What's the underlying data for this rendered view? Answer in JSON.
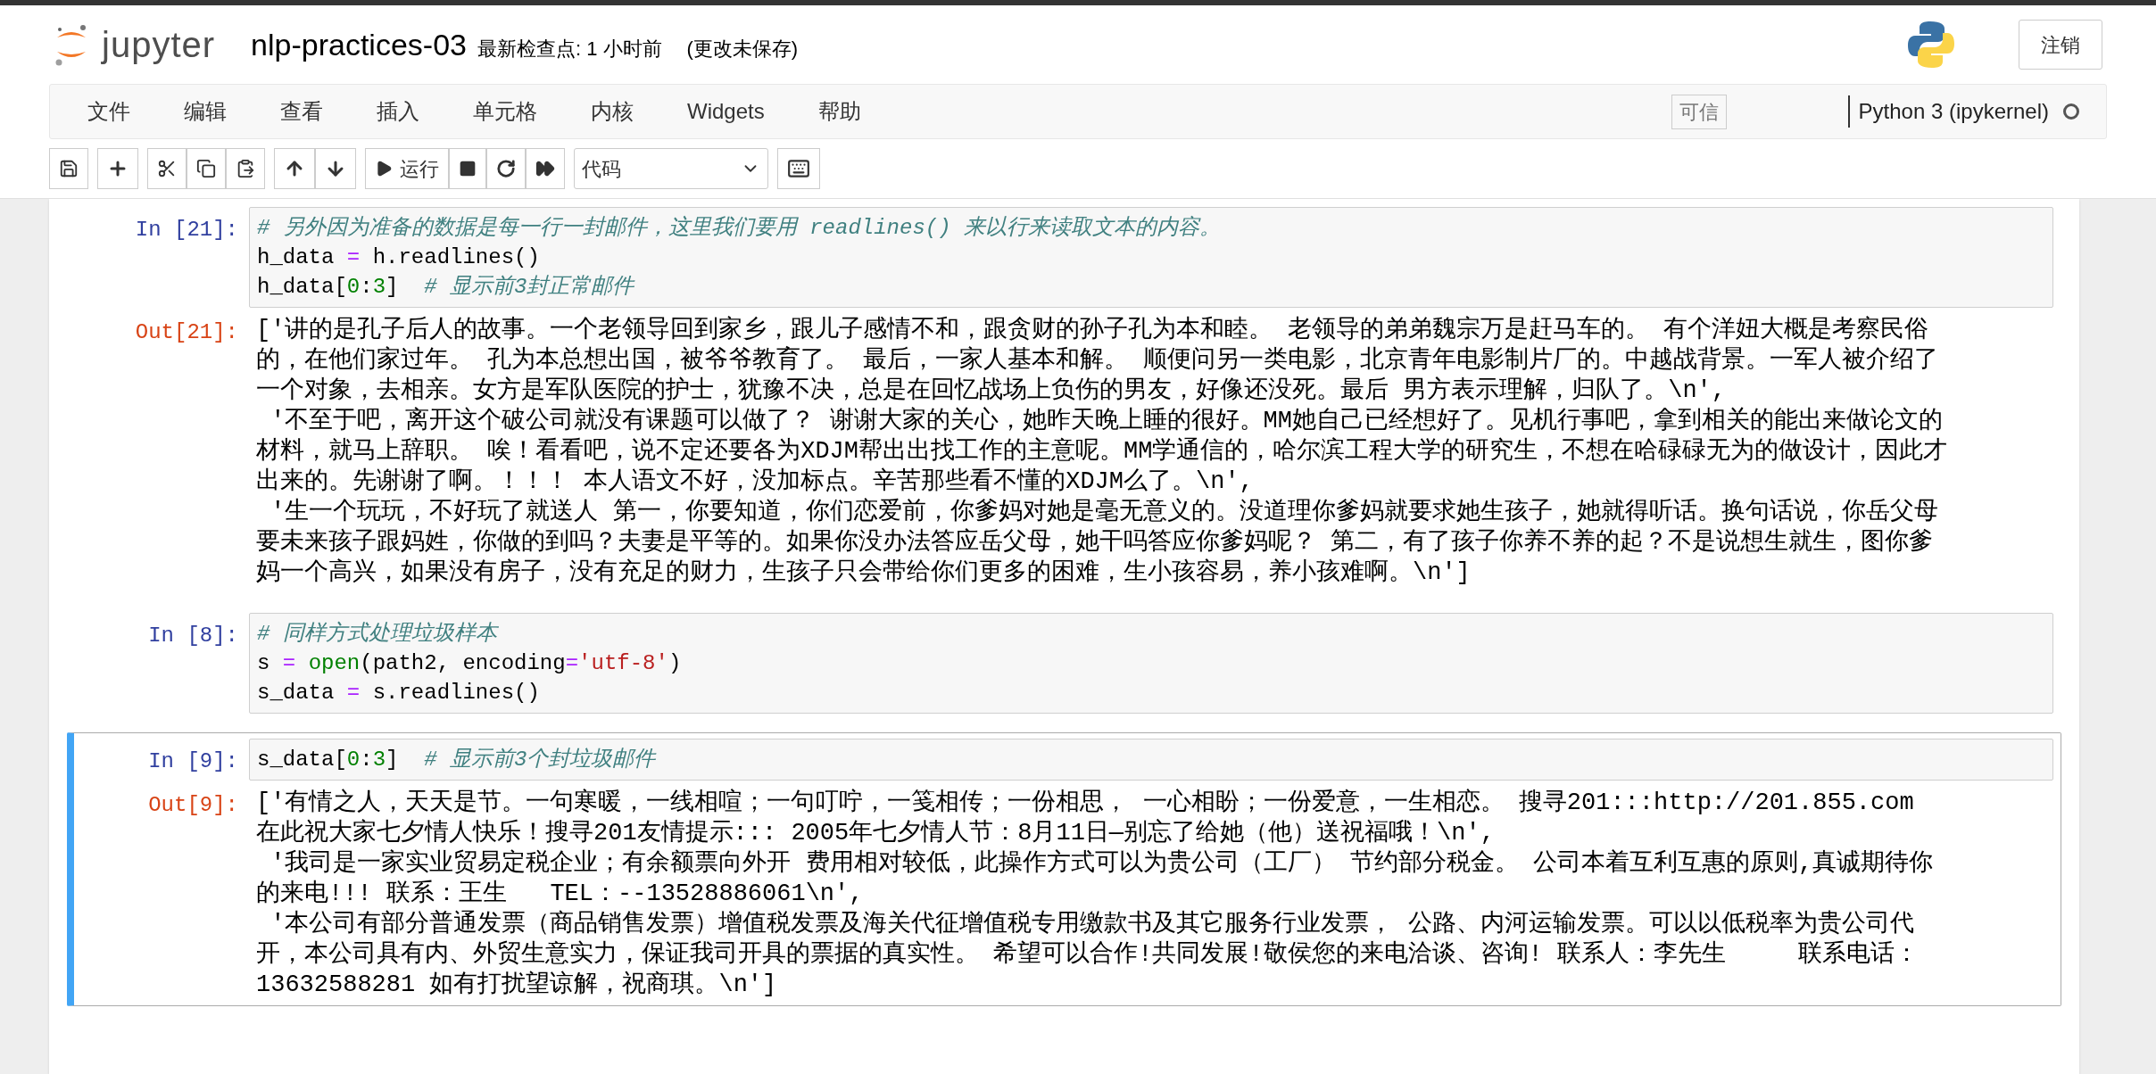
{
  "header": {
    "logo_text": "jupyter",
    "notebook_name": "nlp-practices-03",
    "checkpoint": "最新检查点: 1 小时前",
    "unsaved": "(更改未保存)",
    "logout": "注销"
  },
  "menu": [
    "文件",
    "编辑",
    "查看",
    "插入",
    "单元格",
    "内核",
    "Widgets",
    "帮助"
  ],
  "trusted": "可信",
  "kernel": {
    "name": "Python 3 (ipykernel)",
    "busy": false
  },
  "toolbar": {
    "run_label": "运行",
    "cell_type": "代码"
  },
  "cells": [
    {
      "prompt": "In [21]:",
      "selected": false,
      "code": [
        [
          {
            "kind": "comment",
            "text": "# 另外因为准备的数据是每一行一封邮件，这里我们要用 readlines() 来以行来读取文本的内容。"
          }
        ],
        [
          {
            "kind": "plain",
            "text": "h_data "
          },
          {
            "kind": "operator",
            "text": "="
          },
          {
            "kind": "plain",
            "text": " h.readlines()"
          }
        ],
        [
          {
            "kind": "plain",
            "text": "h_data["
          },
          {
            "kind": "number",
            "text": "0"
          },
          {
            "kind": "plain",
            "text": ":"
          },
          {
            "kind": "number",
            "text": "3"
          },
          {
            "kind": "plain",
            "text": "]  "
          },
          {
            "kind": "comment",
            "text": "# 显示前3封正常邮件"
          }
        ]
      ],
      "output": {
        "prompt": "Out[21]:",
        "lines": [
          "['讲的是孔子后人的故事。一个老领导回到家乡，跟儿子感情不和，跟贪财的孙子孔为本和睦。 老领导的弟弟魏宗万是赶马车的。 有个洋妞大概是考察民俗",
          "的，在他们家过年。 孔为本总想出国，被爷爷教育了。 最后，一家人基本和解。 顺便问另一类电影，北京青年电影制片厂的。中越战背景。一军人被介绍了",
          "一个对象，去相亲。女方是军队医院的护士，犹豫不决，总是在回忆战场上负伤的男友，好像还没死。最后 男方表示理解，归队了。\\n',",
          " '不至于吧，离开这个破公司就没有课题可以做了？ 谢谢大家的关心，她昨天晚上睡的很好。MM她自己已经想好了。见机行事吧，拿到相关的能出来做论文的",
          "材料，就马上辞职。 唉！看看吧，说不定还要各为XDJM帮出出找工作的主意呢。MM学通信的，哈尔滨工程大学的研究生，不想在哈碌碌无为的做设计，因此才",
          "出来的。先谢谢了啊。！！！ 本人语文不好，没加标点。辛苦那些看不懂的XDJM么了。\\n',",
          " '生一个玩玩，不好玩了就送人 第一，你要知道，你们恋爱前，你爹妈对她是毫无意义的。没道理你爹妈就要求她生孩子，她就得听话。换句话说，你岳父母",
          "要未来孩子跟妈姓，你做的到吗？夫妻是平等的。如果你没办法答应岳父母，她干吗答应你爹妈呢？ 第二，有了孩子你养不养的起？不是说想生就生，图你爹",
          "妈一个高兴，如果没有房子，没有充足的财力，生孩子只会带给你们更多的困难，生小孩容易，养小孩难啊。\\n']"
        ]
      }
    },
    {
      "prompt": "In [8]:",
      "selected": false,
      "code": [
        [
          {
            "kind": "comment",
            "text": "# 同样方式处理垃圾样本"
          }
        ],
        [
          {
            "kind": "plain",
            "text": "s "
          },
          {
            "kind": "operator",
            "text": "= "
          },
          {
            "kind": "builtin",
            "text": "open"
          },
          {
            "kind": "plain",
            "text": "(path2, encoding"
          },
          {
            "kind": "operator",
            "text": "="
          },
          {
            "kind": "string",
            "text": "'utf-8'"
          },
          {
            "kind": "plain",
            "text": ")"
          }
        ],
        [
          {
            "kind": "plain",
            "text": "s_data "
          },
          {
            "kind": "operator",
            "text": "="
          },
          {
            "kind": "plain",
            "text": " s.readlines()"
          }
        ]
      ]
    },
    {
      "prompt": "In [9]:",
      "selected": true,
      "code": [
        [
          {
            "kind": "plain",
            "text": "s_data["
          },
          {
            "kind": "number",
            "text": "0"
          },
          {
            "kind": "plain",
            "text": ":"
          },
          {
            "kind": "number",
            "text": "3"
          },
          {
            "kind": "plain",
            "text": "]  "
          },
          {
            "kind": "comment",
            "text": "# 显示前3个封垃圾邮件"
          }
        ]
      ],
      "output": {
        "prompt": "Out[9]:",
        "lines": [
          "['有情之人，天天是节。一句寒暖，一线相喧；一句叮咛，一笺相传；一份相思， 一心相盼；一份爱意，一生相恋。 搜寻201:::http://201.855.com",
          "在此祝大家七夕情人快乐！搜寻201友情提示::: 2005年七夕情人节：8月11日—别忘了给她（他）送祝福哦！\\n',",
          " '我司是一家实业贸易定税企业；有余额票向外开 费用相对较低，此操作方式可以为贵公司（工厂） 节约部分税金。 公司本着互利互惠的原则,真诚期待你",
          "的来电!!! 联系：王生   TEL：--13528886061\\n',",
          " '本公司有部分普通发票（商品销售发票）增值税发票及海关代征增值税专用缴款书及其它服务行业发票， 公路、内河运输发票。可以以低税率为贵公司代",
          "开，本公司具有内、外贸生意实力，保证我司开具的票据的真实性。 希望可以合作!共同发展!敬侯您的来电洽谈、咨询! 联系人：李先生     联系电话：",
          "13632588281 如有打扰望谅解，祝商琪。\\n']"
        ]
      }
    }
  ]
}
